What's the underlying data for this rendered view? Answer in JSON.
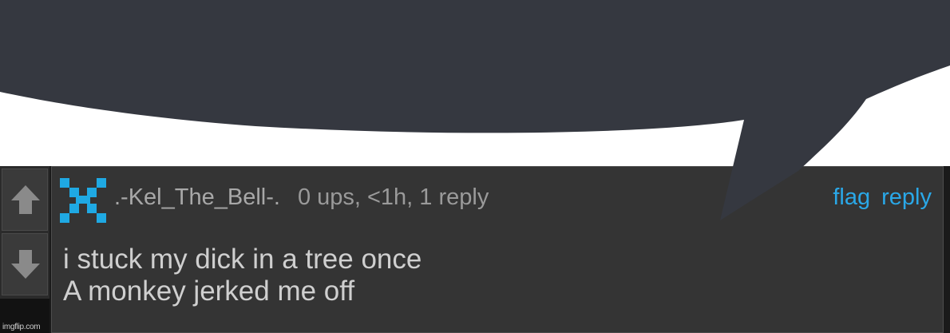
{
  "comment": {
    "username": ".-Kel_The_Bell-.",
    "meta": "0 ups, <1h, 1 reply",
    "actions": {
      "flag": "flag",
      "reply": "reply"
    },
    "lines": [
      "i stuck my dick in a tree once",
      "A monkey jerked me off"
    ]
  },
  "vote": {
    "upvote_icon": "arrow-up-icon",
    "downvote_icon": "arrow-down-icon"
  },
  "watermark": "imgflip.com",
  "colors": {
    "bubble": "#353840",
    "panel": "#343434",
    "link": "#2aa8e8",
    "avatar": "#1fa9e3"
  }
}
